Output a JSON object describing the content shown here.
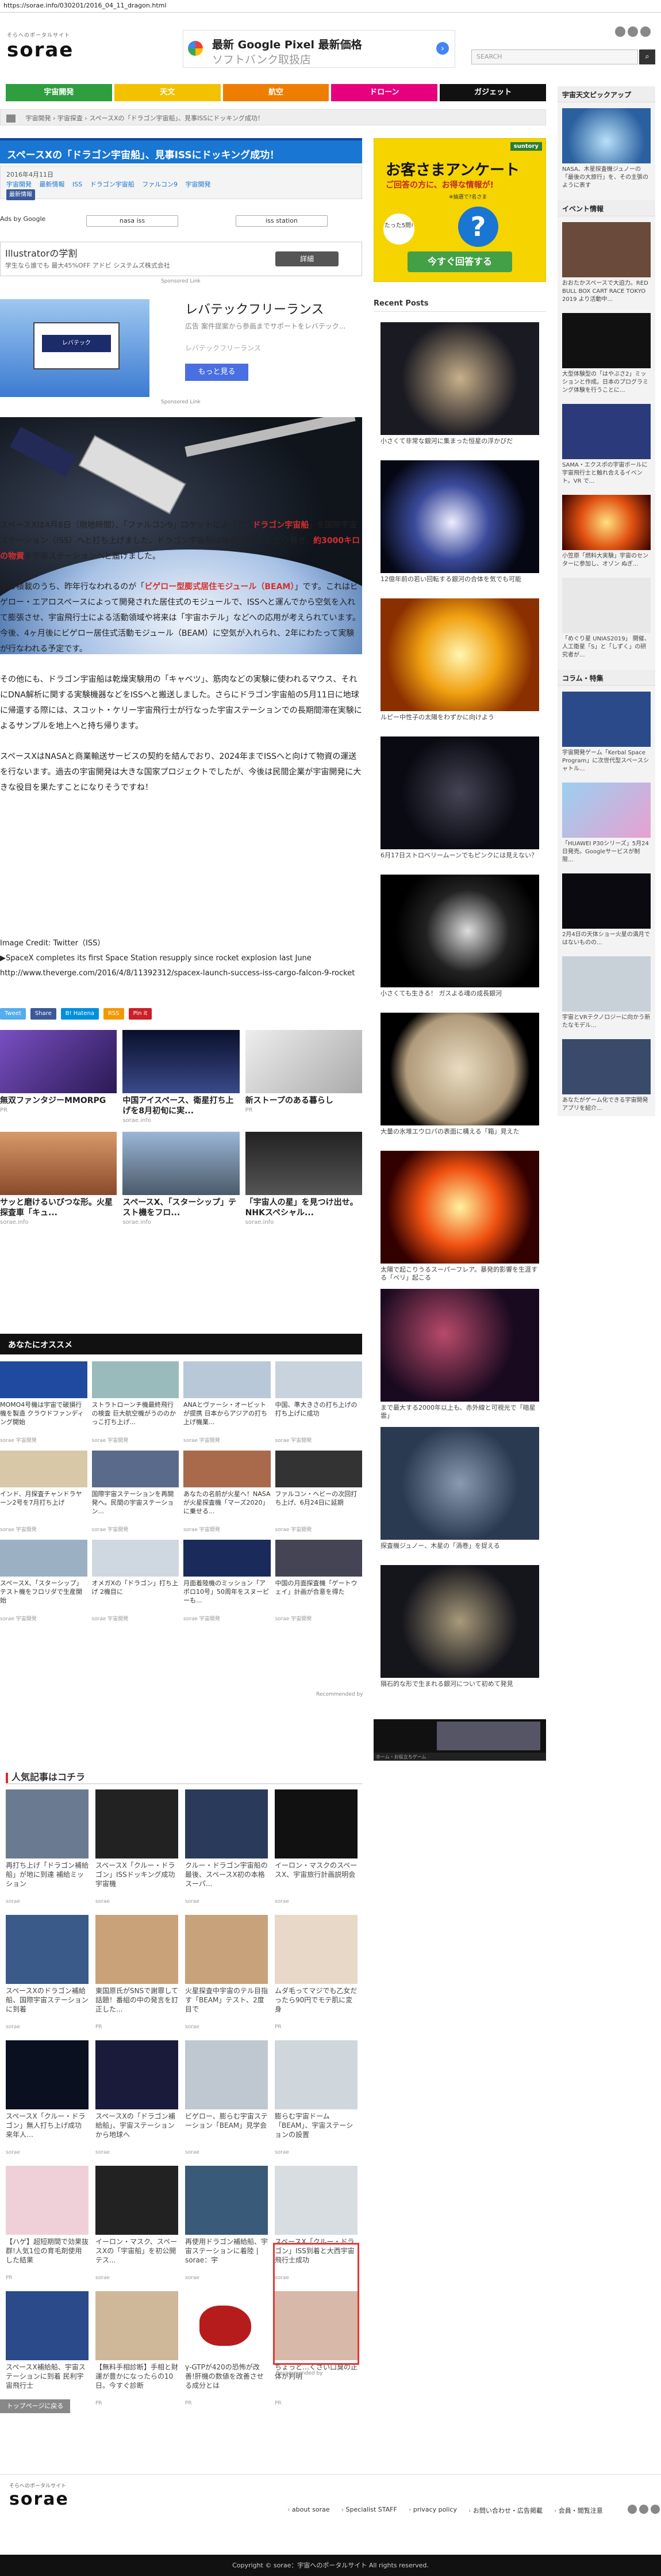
{
  "url": "https://sorae.info/030201/2016_04_11_dragon.html",
  "site": {
    "tagline": "そらへのポータルサイト",
    "name": "sorae"
  },
  "ad_top": {
    "line1": "最新 Google Pixel 最新価格",
    "line2": "ソフトバンク取扱店"
  },
  "search_placeholder": "SEARCH",
  "nav": [
    {
      "label": "宇宙開発",
      "color": "#2e9e3e"
    },
    {
      "label": "天文",
      "color": "#f2c200"
    },
    {
      "label": "航空",
      "color": "#ef7d00"
    },
    {
      "label": "ドローン",
      "color": "#e6007e"
    },
    {
      "label": "ガジェット",
      "color": "#111111"
    }
  ],
  "breadcrumb": [
    "宇宙開発",
    "宇宙探査",
    "スペースXの「ドラゴン宇宙船」、見事ISSにドッキング成功！"
  ],
  "article": {
    "title": "スペースXの「ドラゴン宇宙船」、見事ISSにドッキング成功！",
    "date": "2016年4月11日",
    "tags": [
      "宇宙開発",
      "最新情報",
      "ISS",
      "ドラゴン宇宙船",
      "ファルコン9",
      "宇宙開発"
    ],
    "author": "最新情報",
    "p1_a": "スペースXは4月8日（現地時間）、「ファルコン9」ロケットによって「",
    "p1_hl": "ドラゴン宇宙船",
    "p1_b": "」を国際宇宙ステーション（ISS）へと打ち上げました。ドラゴン宇宙船は無事ISSへとたどり着き、",
    "p1_hl2": "約3000キロの物資",
    "p1_c": "を宇宙ステーションへと届けました。",
    "p2_a": "その積載のうち、昨年行なわれるのが「",
    "p2_hl": "ビゲロー型膨式居住モジュール（BEAM）",
    "p2_b": "」です。これはビゲロー・エアロスペースによって開発された居住式のモジュールで、ISSへと運んでから空気を入れて膨張させ、宇宙飛行士による活動領域や将来は「宇宙ホテル」などへの応用が考えられています。今後、4ヶ月後にビゲロー居住式活動モジュール（BEAM）に空気が入れられ、2年にわたって実験が行なわれる予定です。",
    "p3": "その他にも、ドラゴン宇宙船は乾燥実験用の「キャベツ」、筋肉などの実験に使われるマウス、それにDNA解析に関する実験機器などをISSへと搬送しました。さらにドラゴン宇宙船の5月11日に地球に帰還する際には、スコット・ケリー宇宙飛行士が行なった宇宙ステーションでの長期間滞在実験によるサンプルを地上へと持ち帰ります。",
    "p4": "スペースXはNASAと商業輸送サービスの契約を結んでおり、2024年までISSへと向けて物資の運送を行ないます。過去の宇宙開発は大きな国家プロジェクトでしたが、今後は民間企業が宇宙開発に大きな役目を果たすことになりそうですね！",
    "credit_label": "Image Credit: Twitter（ISS）",
    "source_title": "▶SpaceX completes its first Space Station resupply since rocket explosion last June",
    "source_url": "http://www.theverge.com/2016/4/8/11392312/spacex-launch-success-iss-cargo-falcon-9-rocket"
  },
  "adsby": {
    "label": "Ads by Google",
    "chip1": "nasa iss",
    "chip2": "iss station"
  },
  "ad_illustrator": {
    "title": "Illustratorの学割",
    "sub": "学生なら誰でも 最大45%OFF アドビ システムズ株式会社",
    "button": "詳細",
    "note": "Sponsored Link"
  },
  "ad_lapad": {
    "title": "レバテックフリーランス",
    "desc": "広告 案件提案から参画までサポートをレバテック...",
    "desc2": "レバテックフリーランス",
    "button": "もっと見る",
    "note": "Sponsored Link",
    "box": "レバテック"
  },
  "share": [
    {
      "label": "Tweet",
      "color": "#55acee"
    },
    {
      "label": "Share",
      "color": "#3b5998"
    },
    {
      "label": "B! Hatena",
      "color": "#008fde"
    },
    {
      "label": "RSS",
      "color": "#f39800"
    },
    {
      "label": "Pin it",
      "color": "#cb2027"
    }
  ],
  "related": [
    {
      "title": "無双ファンタジーMMORPG",
      "src": "PR"
    },
    {
      "title": "中国アイスペース、衛星打ち上げを8月初旬に実...",
      "src": "sorae.info"
    },
    {
      "title": "新ストープのある暮らし",
      "src": "PR"
    },
    {
      "title": "サッと磨けるいびつな形。火星探査車「キュ...",
      "src": "sorae.info"
    },
    {
      "title": "スペースX、「スターシップ」テスト機をフロ...",
      "src": "sorae.info"
    },
    {
      "title": "「宇宙人の星」を見つけ出せ。NHKスペシャル...",
      "src": "sorae.info"
    }
  ],
  "osusume_title": "あなたにオススメ",
  "rec": [
    {
      "title": "MOMO4号機は宇宙で破損行機を製造 クラウドファンディング開始",
      "src": "sorae 宇宙開発"
    },
    {
      "title": "ストラトローンチ機最終飛行の検査 巨大航空機がうののかっこ打ち上げ...",
      "src": "sorae 宇宙開発"
    },
    {
      "title": "ANAとヴァーシ・オービットが提携 日本からアジアの打ち上げ機業...",
      "src": "sorae 宇宙開発"
    },
    {
      "title": "中国、準大きさの打ち上げの打ち上げに成功",
      "src": "sorae 宇宙開発"
    },
    {
      "title": "インド、月探査チャンドラヤーン2号を7月打ち上げ",
      "src": "sorae 宇宙開発"
    },
    {
      "title": "国際宇宙ステーションを再開発へ。民間の宇宙ステーション...",
      "src": "sorae 宇宙開発"
    },
    {
      "title": "あなたの名前が火星へ！NASAが火星探査機「マーズ2020」に乗せる...",
      "src": "sorae 宇宙開発"
    },
    {
      "title": "ファルコン・ヘビーの次回打ち上げ、6月24日に延期",
      "src": "sorae 宇宙開発"
    },
    {
      "title": "スペースX、「スターシップ」テスト機をフロリダで生産開始",
      "src": "sorae 宇宙開発"
    },
    {
      "title": "オメガXの「ドラゴン」打ち上げ 2機目に",
      "src": "sorae 宇宙開発"
    },
    {
      "title": "月面着陸機のミッション「アポロ10号」50周年をスヌーピーも...",
      "src": "sorae 宇宙開発"
    },
    {
      "title": "中国の月面探査機「ゲートウェイ」計画が合意を得た",
      "src": "sorae 宇宙開発"
    }
  ],
  "rec_credit": "Recommended by",
  "popular_title": "人気記事はコチラ",
  "popular": [
    {
      "title": "再打ち上げ「ドラゴン補給船」が地に到達 補給ミッション",
      "src": "sorae"
    },
    {
      "title": "スペースX「クルー・ドラゴン」ISSドッキング成功 宇宙機",
      "src": "sorae"
    },
    {
      "title": "クルー・ドラゴン宇宙船の最後、スペースX初の本格 スーパ...",
      "src": "sorae"
    },
    {
      "title": "イーロン・マスクのスペースX、宇宙旅行計画説明会",
      "src": "sorae"
    },
    {
      "title": "スペースXのドラゴン補給船、国際宇宙ステーションに到着",
      "src": "sorae"
    },
    {
      "title": "東国原氏がSNSで謝罪して話題！番組の中の発言を訂正した...",
      "src": "PR"
    },
    {
      "title": "火星探査中宇宙のテル目指す「BEAM」テスト、2度目で",
      "src": "sorae"
    },
    {
      "title": "ムダ毛ってマジでも乙女だったら90円でモテ肌に変身",
      "src": "PR"
    },
    {
      "title": "スペースX「クルー・ドラゴン」無人打ち上げ成功 来年人…",
      "src": "sorae"
    },
    {
      "title": "スペースXの「ドラゴン補給船」、宇宙ステーションから地球へ",
      "src": "sorae"
    },
    {
      "title": "ビゲロー、膨らむ宇宙ステーション「BEAM」見学会",
      "src": "sorae"
    },
    {
      "title": "膨らむ宇宙ドーム「BEAM」、宇宙ステーションの設置",
      "src": "sorae"
    },
    {
      "title": "【ハゲ】超短期間で効果抜群!人気1位の育毛剤使用した結果",
      "src": "PR"
    },
    {
      "title": "イーロン・マスク、スペースXの「宇宙船」を初公開 テス...",
      "src": "sorae"
    },
    {
      "title": "再使用ドラゴン補給船、宇宙ステーションに着陸 | sorae：宇",
      "src": "sorae"
    },
    {
      "title": "スペースX「クルー・ドラゴン」ISS到着と大西宇宙飛行士成功",
      "src": "sorae"
    },
    {
      "title": "スペースX補給船、宇宙ステーションに到着 民利宇宙飛行士",
      "src": "sorae"
    },
    {
      "title": "【無料手相診断】手相と財運が豊かになったらの10日。今すぐ診断",
      "src": "PR"
    },
    {
      "title": "γ-GTPが420の恐怖が改善!肝機の数値を改善させる成分とは",
      "src": "PR"
    },
    {
      "title": "ちょっと…くさい口臭の正体が判明",
      "src": "PR"
    }
  ],
  "pop_credit": "Recommended by",
  "toplink": "トップページに戻る",
  "survey_ad": {
    "brand": "suntory",
    "t1": "お客さまアンケート",
    "t2": "ご回答の方に、お得な情報が!",
    "t3": "※抽選で?名さま",
    "bubble": "たった5問!",
    "button": "今すぐ回答する"
  },
  "recent_posts_title": "Recent Posts",
  "recent_posts": [
    "小さくて非常な銀河に集まった恒星の浮かびだ",
    "12億年前の若い回転する銀河の合体を気でも可能",
    "ルピー中性子の太陽をわずかに向けよう",
    "6月17日ストロベリームーンでもピンクには見えない？",
    "小さくても生きる！ ガスよる魂の成長銀河",
    "大量の氷堆エウロパの表面に構える「箱」見えた",
    "太陽で起こりうるスーパーフレア。暴発的影響を生涯する「ベリ」起こる",
    "まで最大する2000年以上も、赤外線と可視光で「暗星雲」",
    "探査機ジュノー、木星の「渦巻」を捉える",
    "隕石的な形で生まれる銀河について初めて発見"
  ],
  "video_bar": "ホーム・お役立ちゲーム",
  "far_right": {
    "pickup_title": "宇宙天文ピックアップ",
    "pickup": [
      {
        "title": "NASA、木星探査機ジュノーの「最後の大旅行」を、その主張のように表す"
      }
    ],
    "events_title": "イベント情報",
    "events": [
      {
        "title": "おおたかスペースで大迫力。RED BULL BOX CART RACE TOKYO 2019 より活動中..."
      },
      {
        "title": "大型体験型の「はやぶさ2」ミッションと作成。日本のプログラミング体験を行うことに..."
      },
      {
        "title": "SAMA・エクスポの宇宙ボールに宇宙飛行士と触れ合えるイベント。VR で..."
      },
      {
        "title": "小笠原「燃料大実験」宇宙のセンターに参加し、オゾン ぬぎ..."
      },
      {
        "title": "「めぐり星 UNIAS2019」 開催、人工衛星「S」と「しずく」の研究者が..."
      }
    ],
    "column_title": "コラム・特集",
    "column": [
      {
        "title": "宇宙開発ゲーム「Kerbal Space Program」に次世代型スペースシャトル..."
      },
      {
        "title": "「HUAWEI P30シリーズ」5月24日発売。Googleサービスが制限..."
      },
      {
        "title": "2月4日の天体ショー火星の満月ではないものの..."
      },
      {
        "title": "宇宙とVRテクノロジーに向かう新たなモデル..."
      },
      {
        "title": "あなたがゲーム化できる宇宙開発アプリを紹介..."
      }
    ]
  },
  "footer": {
    "links": [
      "about sorae",
      "Specialist STAFF",
      "privacy policy",
      "お問い合わせ・広告掲載",
      "会員・閲覧注意"
    ],
    "copyright": "Copyright © sorae：宇宙へのポータルサイト All rights reserved."
  }
}
